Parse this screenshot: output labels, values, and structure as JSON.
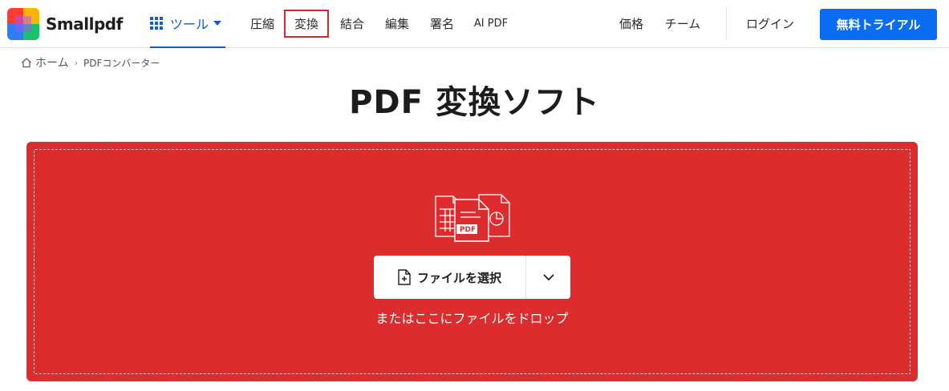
{
  "brand": {
    "name": "Smallpdf",
    "logo_colors": [
      "#ff3b30",
      "#ffb400",
      "#16c36b",
      "#2e7cf6",
      "#a855f7",
      "#ff5ca8"
    ]
  },
  "nav": {
    "tools_label": "ツール",
    "items": [
      "圧縮",
      "変換",
      "結合",
      "編集",
      "署名",
      "AI PDF"
    ],
    "active_item": "変換",
    "pricing": "価格",
    "team": "チーム",
    "login": "ログイン",
    "trial": "無料トライアル"
  },
  "breadcrumb": {
    "home": "ホーム",
    "current": "PDFコンバーター"
  },
  "page": {
    "title": "PDF 変換ソフト"
  },
  "dropzone": {
    "pdf_badge": "PDF",
    "select_label": "ファイルを選択",
    "hint": "またはここにファイルをドロップ"
  },
  "colors": {
    "accent_blue": "#0a6cf0",
    "dropzone_red": "#dc2c2e",
    "active_outline": "#d8282c"
  }
}
